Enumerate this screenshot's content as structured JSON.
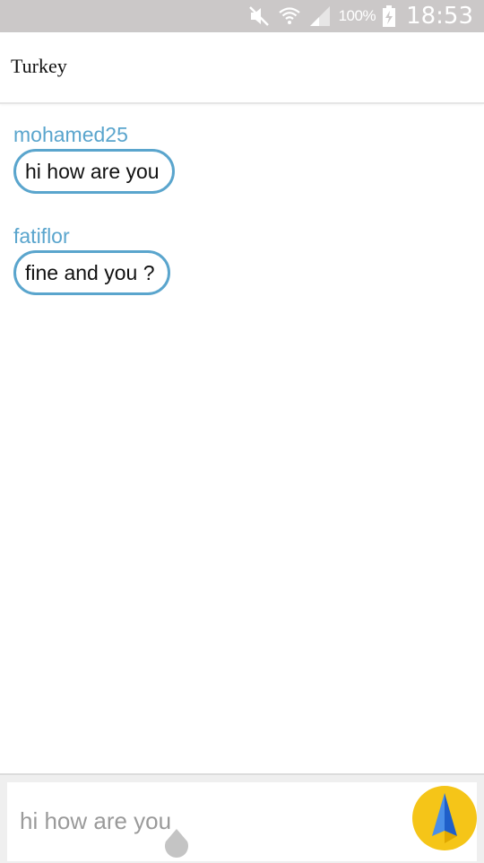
{
  "status_bar": {
    "battery": "100%",
    "time": "18:53",
    "icons": [
      "mute-icon",
      "wifi-icon",
      "signal-icon",
      "battery-charging-icon"
    ]
  },
  "header": {
    "title": "Turkey"
  },
  "messages": [
    {
      "user": "mohamed25",
      "text": "hi how are you"
    },
    {
      "user": "fatiflor",
      "text": "fine and you ?"
    }
  ],
  "composer": {
    "placeholder": "hi how are you",
    "send_icon": "send-arrow-icon"
  },
  "colors": {
    "accent": "#5aa5cd",
    "status_bar": "#cbc8c8",
    "send_button": "#f5c518",
    "send_arrow": "#2a6fd8"
  }
}
